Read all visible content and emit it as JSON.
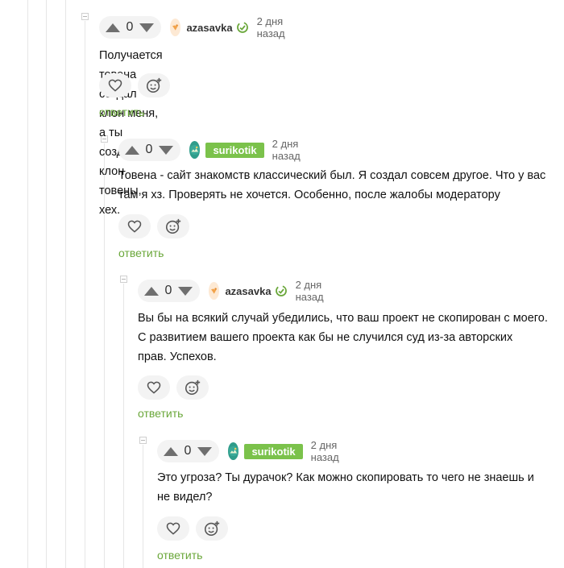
{
  "reply_label": "ответить",
  "comments": [
    {
      "score": "0",
      "username": "azasavka",
      "time": "2 дня назад",
      "text": [
        "Получается товена создал клон меня, а ты создал клон товены, хех."
      ]
    },
    {
      "score": "0",
      "username": "surikotik",
      "time": "2 дня назад",
      "text": [
        "Товена - сайт знакомств классический был. Я создал совсем другое. Что у вас",
        "там я хз. Проверять не хочется. Особенно, после жалобы модератору"
      ]
    },
    {
      "score": "0",
      "username": "azasavka",
      "time": "2 дня назад",
      "text": [
        "Вы бы на всякий случай убедились, что ваш проект не скопирован с моего.",
        "С развитием вашего проекта как бы не случился суд из-за авторских",
        "прав. Успехов."
      ]
    },
    {
      "score": "0",
      "username": "surikotik",
      "time": "2 дня назад",
      "text": [
        "Это угроза? Ты дурачок? Как можно скопировать то чего не знаешь и",
        "не видел?"
      ]
    }
  ],
  "colors": {
    "accent": "#6aa73a",
    "badge": "#7bc24b",
    "surface": "#f3f3f3"
  },
  "icons": [
    "vote-up-icon",
    "vote-down-icon",
    "heart-icon",
    "add-emoji-icon",
    "author-badge-icon",
    "collapse-icon"
  ]
}
